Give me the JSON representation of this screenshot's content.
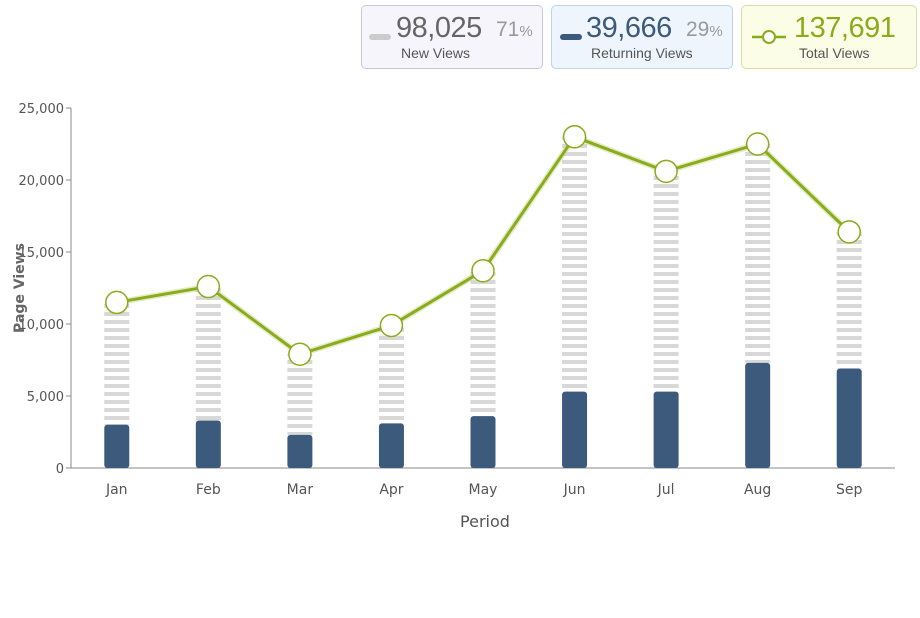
{
  "legend": {
    "new_views": {
      "value": "98,025",
      "percent": "71",
      "percent_symbol": "%",
      "label": "New Views",
      "color": "#cccccc",
      "text_color": "#666666"
    },
    "returning_views": {
      "value": "39,666",
      "percent": "29",
      "percent_symbol": "%",
      "label": "Returning Views",
      "color": "#3c5a7c",
      "text_color": "#3c5a7c"
    },
    "total_views": {
      "value": "137,691",
      "label": "Total Views",
      "color": "#8aab1a",
      "text_color": "#8aab1a"
    }
  },
  "chart_data": {
    "type": "bar",
    "categories": [
      "Jan",
      "Feb",
      "Mar",
      "Apr",
      "May",
      "Jun",
      "Jul",
      "Aug",
      "Sep"
    ],
    "series": [
      {
        "name": "Returning Views",
        "kind": "bar",
        "color": "#3c5a7c",
        "values": [
          3000,
          3300,
          2300,
          3100,
          3600,
          5300,
          5300,
          7300,
          6900
        ]
      },
      {
        "name": "New Views",
        "kind": "bar-stacked-striped",
        "color": "#d8d8d8",
        "values": [
          8500,
          9300,
          5600,
          6800,
          10100,
          17700,
          15300,
          15200,
          9500
        ]
      },
      {
        "name": "Total Views",
        "kind": "line",
        "color": "#8aab1a",
        "values": [
          11500,
          12600,
          7900,
          9900,
          13700,
          23000,
          20600,
          22500,
          16400
        ]
      }
    ],
    "xlabel": "Period",
    "ylabel": "Page Views",
    "ylim": [
      0,
      25000
    ],
    "yticks": [
      0,
      5000,
      10000,
      15000,
      20000,
      25000
    ],
    "ytick_labels": [
      "0",
      "5,000",
      "10,000",
      "15,000",
      "20,000",
      "25,000"
    ],
    "grid": false
  }
}
